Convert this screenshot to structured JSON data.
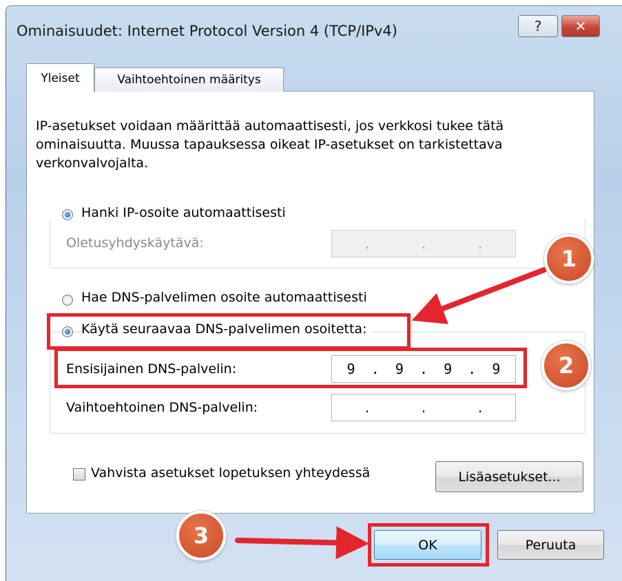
{
  "window": {
    "title": "Ominaisuudet: Internet Protocol Version 4 (TCP/IPv4)",
    "help_glyph": "?",
    "close_glyph": "✕"
  },
  "tabs": [
    {
      "label": "Yleiset",
      "selected": true
    },
    {
      "label": "Vaihtoehtoinen määritys",
      "selected": false
    }
  ],
  "intro_text": "IP-asetukset voidaan määrittää automaattisesti, jos verkkosi tukee tätä ominaisuutta. Muussa tapauksessa oikeat IP-asetukset on tarkistettava verkonvalvojalta.",
  "ip_section": {
    "auto_ip_label": "Hanki IP-osoite automaattisesti",
    "auto_ip_checked": true,
    "gateway_label": "Oletusyhdyskäytävä:",
    "gateway_value": ". . ."
  },
  "dns_section": {
    "auto_dns_label": "Hae DNS-palvelimen osoite automaattisesti",
    "auto_dns_checked": false,
    "manual_dns_label": "Käytä seuraavaa DNS-palvelimen osoitetta:",
    "manual_dns_checked": true,
    "primary_label": "Ensisijainen DNS-palvelin:",
    "primary_octets": [
      "9",
      "9",
      "9",
      "9"
    ],
    "secondary_label": "Vaihtoehtoinen DNS-palvelin:",
    "secondary_value": ". . ."
  },
  "validate": {
    "label": "Vahvista asetukset lopetuksen yhteydessä",
    "checked": false
  },
  "buttons": {
    "advanced": "Lisäasetukset...",
    "ok": "OK",
    "cancel": "Peruuta"
  },
  "annotations": {
    "badge_1": "1",
    "badge_2": "2",
    "badge_3": "3",
    "highlight_color": "#e3262e",
    "badge_color": "#d65a31"
  }
}
